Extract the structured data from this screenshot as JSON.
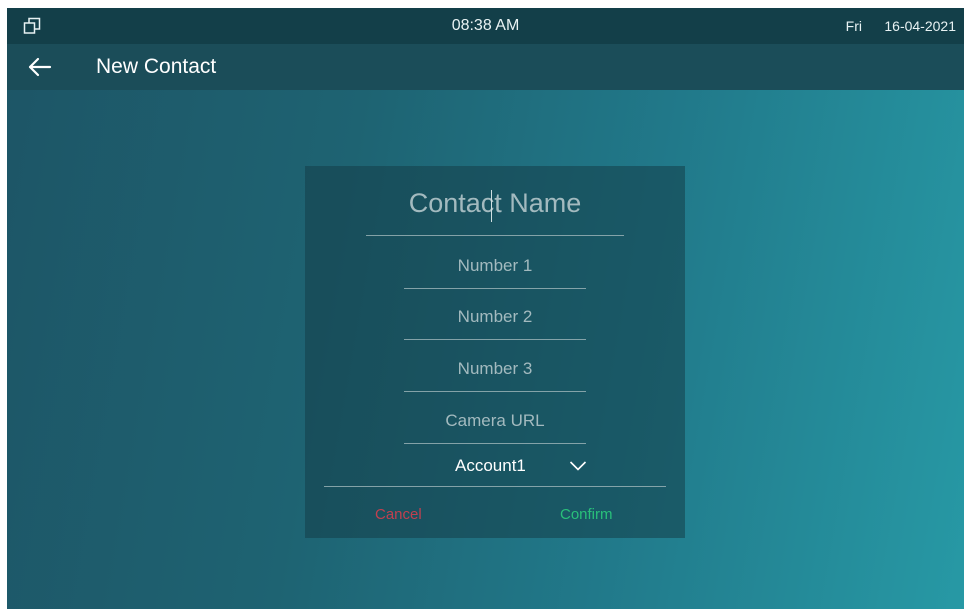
{
  "status_bar": {
    "window_icon": "restore-window-icon",
    "time": "08:38 AM",
    "day": "Fri",
    "date": "16-04-2021"
  },
  "header": {
    "back_icon": "arrow-left-icon",
    "title": "New Contact"
  },
  "form": {
    "contact_name_placeholder": "Contact Name",
    "number1_placeholder": "Number 1",
    "number2_placeholder": "Number 2",
    "number3_placeholder": "Number 3",
    "camera_url_placeholder": "Camera URL",
    "account_value": "Account1",
    "account_icon": "chevron-down-icon",
    "cancel_label": "Cancel",
    "confirm_label": "Confirm"
  },
  "colors": {
    "cancel": "#c1404f",
    "confirm": "#29c07a",
    "status_bar": "#133f49",
    "title_bar": "#1b4d59"
  }
}
